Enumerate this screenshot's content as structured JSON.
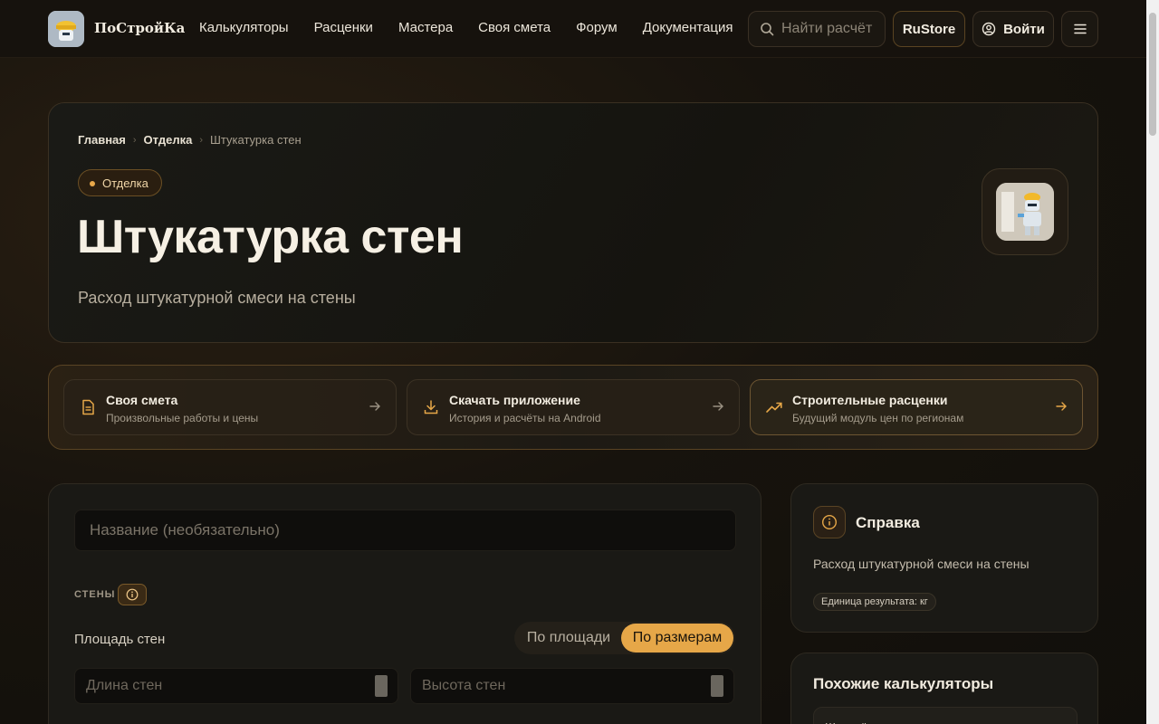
{
  "header": {
    "brand": "ПоСтройКа",
    "nav": [
      "Калькуляторы",
      "Расценки",
      "Мастера",
      "Своя смета",
      "Форум",
      "Документация"
    ],
    "search_label": "Найти расчёт",
    "rustore_label": "RuStore",
    "login_label": "Войти"
  },
  "hero": {
    "breadcrumb": [
      "Главная",
      "Отделка",
      "Штукатурка стен"
    ],
    "tag": "Отделка",
    "title": "Штукатурка стен",
    "subtitle": "Расход штукатурной смеси на стены"
  },
  "quick_links": [
    {
      "title": "Своя смета",
      "subtitle": "Произвольные работы и цены",
      "icon": "document-icon"
    },
    {
      "title": "Скачать приложение",
      "subtitle": "История и расчёты на Android",
      "icon": "download-icon"
    },
    {
      "title": "Строительные расценки",
      "subtitle": "Будущий модуль цен по регионам",
      "icon": "trend-up-icon"
    }
  ],
  "form": {
    "name_placeholder": "Название (необязательно)",
    "section_label": "СТЕНЫ",
    "field_label": "Площадь стен",
    "segment": {
      "options": [
        "По площади",
        "По размерам"
      ],
      "selected": "По размерам"
    },
    "length_placeholder": "Длина стен",
    "height_placeholder": "Высота стен"
  },
  "help": {
    "title": "Справка",
    "description": "Расход штукатурной смеси на стены",
    "badge": "Единица результата: кг"
  },
  "similar": {
    "title": "Похожие калькуляторы",
    "first_item": "Шпаклёвка"
  },
  "colors": {
    "accent": "#e6a748",
    "background": "#16120d"
  }
}
